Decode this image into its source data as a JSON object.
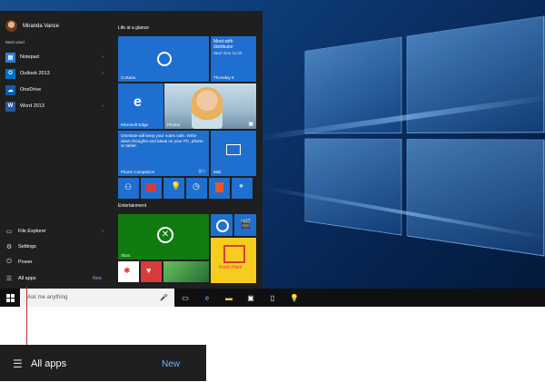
{
  "user": {
    "name": "Miranda Vance"
  },
  "start_menu": {
    "most_used_label": "Most used",
    "most_used": [
      {
        "label": "Notepad",
        "icon": "notepad-icon",
        "color": "#2d7dd2"
      },
      {
        "label": "Outlook 2013",
        "icon": "outlook-icon",
        "color": "#0072c6"
      },
      {
        "label": "OneDrive",
        "icon": "onedrive-icon",
        "color": "#0b5ea8"
      },
      {
        "label": "Word 2013",
        "icon": "word-icon",
        "color": "#2b5797"
      }
    ],
    "bottom": {
      "file_explorer": "File Explorer",
      "settings": "Settings",
      "power": "Power",
      "all_apps": "All apps",
      "new": "New"
    }
  },
  "tiles": {
    "life_label": "Life at a glance",
    "entertainment_label": "Entertainment",
    "cortana": "Cortana",
    "calendar_event": "Meet with distributor",
    "calendar_time": "Start time 11:00",
    "calendar_day": "Thursday 6",
    "edge": "Microsoft Edge",
    "photos": "Photos",
    "phone_text": "OneNote will keep your notes safe. Write down thoughts and ideas on your PC, phone or tablet.",
    "phone_companion": "Phone Companion",
    "mail": "Mail",
    "xbox": "Xbox",
    "freshpaint": "Fresh Paint"
  },
  "taskbar": {
    "search_placeholder": "Ask me anything"
  },
  "callout": {
    "label": "All apps",
    "new": "New"
  },
  "colors": {
    "accent": "#1f6fd0",
    "new_link": "#6fb0ff",
    "callout_line": "#c2282e"
  }
}
